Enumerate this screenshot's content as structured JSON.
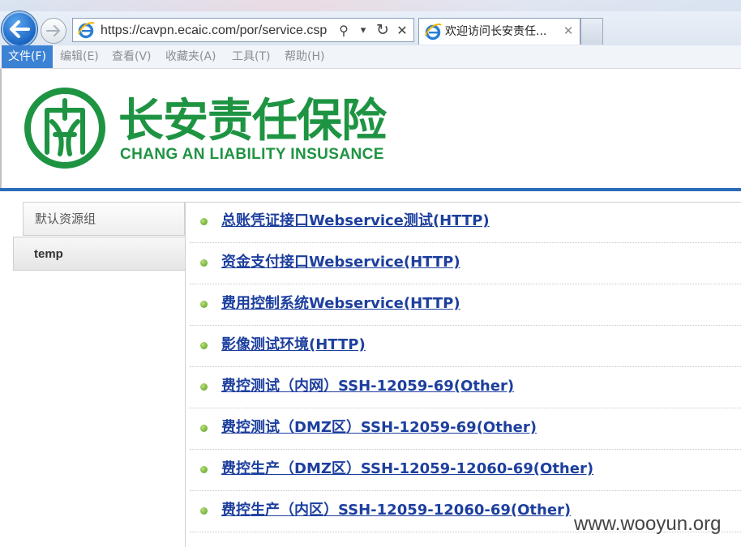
{
  "browser": {
    "address_url": "https://cavpn.ecaic.com/por/service.csp",
    "tab_title": "欢迎访问长安责任...",
    "tab_close": "✕",
    "addr_search": "⚲",
    "addr_dropdown": "▾",
    "addr_refresh": "↻",
    "addr_stop": "✕"
  },
  "menubar": {
    "items": [
      "文件(F)",
      "编辑(E)",
      "查看(V)",
      "收藏夹(A)",
      "工具(T)",
      "帮助(H)"
    ]
  },
  "logo": {
    "cn": "长安责任保险",
    "en": "CHANG AN LIABILITY INSUSANCE",
    "brand_color": "#1e9442"
  },
  "sidebar": {
    "groups": [
      "默认资源组",
      "temp"
    ]
  },
  "resources": [
    "总账凭证接口Webservice测试(HTTP)",
    "资金支付接口Webservice(HTTP)",
    "费用控制系统Webservice(HTTP)",
    "影像测试环境(HTTP)",
    "费控测试（内网）SSH-12059-69(Other)",
    "费控测试（DMZ区）SSH-12059-69(Other)",
    "费控生产（DMZ区）SSH-12059-12060-69(Other)",
    "费控生产（内区）SSH-12059-12060-69(Other)"
  ],
  "watermark": "www.wooyun.org",
  "colors": {
    "link": "#1d3f9e",
    "rule": "#2b6cb8",
    "menu_active": "#3c82d4"
  }
}
